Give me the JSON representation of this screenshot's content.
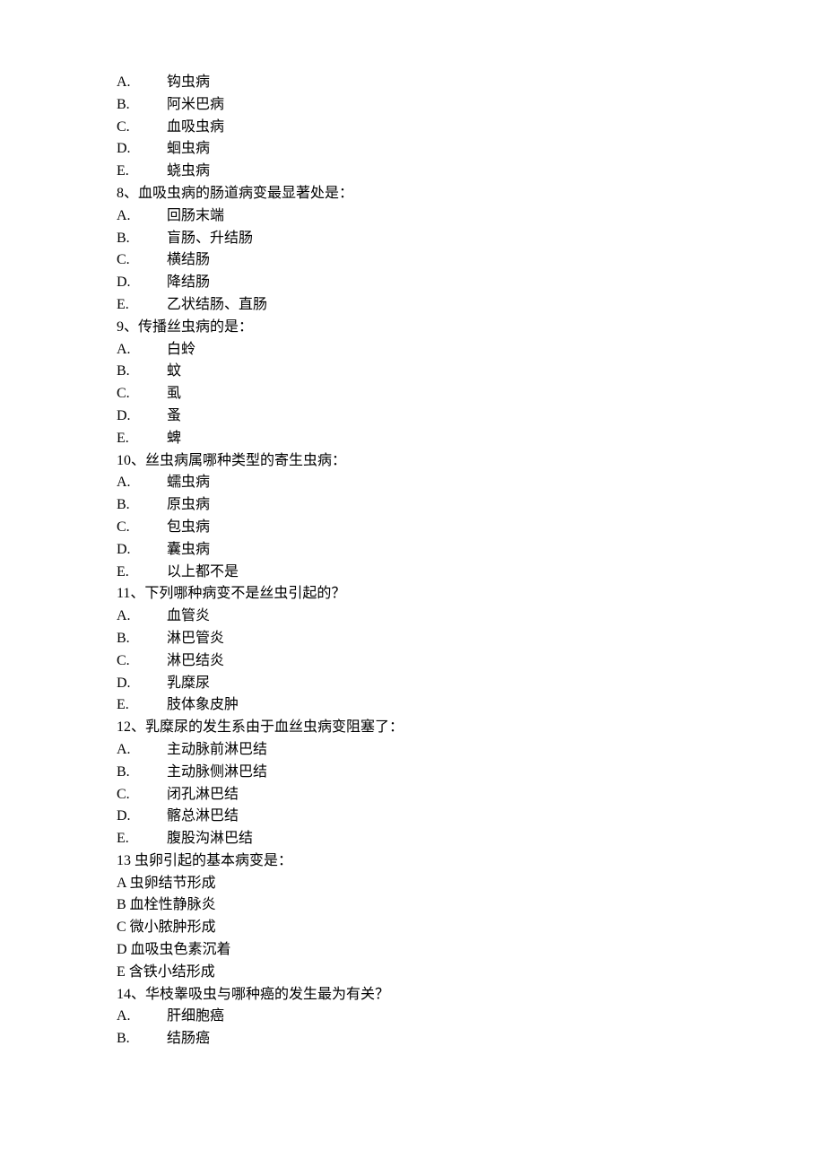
{
  "items": [
    {
      "kind": "option",
      "letter": "A.",
      "text": "钩虫病"
    },
    {
      "kind": "option",
      "letter": "B.",
      "text": "阿米巴病"
    },
    {
      "kind": "option",
      "letter": "C.",
      "text": "血吸虫病"
    },
    {
      "kind": "option",
      "letter": "D.",
      "text": "蛔虫病"
    },
    {
      "kind": "option",
      "letter": "E.",
      "text": "蛲虫病"
    },
    {
      "kind": "question",
      "text": "8、血吸虫病的肠道病变最显著处是："
    },
    {
      "kind": "option",
      "letter": "A.",
      "text": "回肠末端"
    },
    {
      "kind": "option",
      "letter": "B.",
      "text": "盲肠、升结肠"
    },
    {
      "kind": "option",
      "letter": "C.",
      "text": "横结肠"
    },
    {
      "kind": "option",
      "letter": "D.",
      "text": "降结肠"
    },
    {
      "kind": "option",
      "letter": "E.",
      "text": "乙状结肠、直肠"
    },
    {
      "kind": "question",
      "text": "9、传播丝虫病的是："
    },
    {
      "kind": "option",
      "letter": "A.",
      "text": "白蛉"
    },
    {
      "kind": "option",
      "letter": "B.",
      "text": "蚊"
    },
    {
      "kind": "option",
      "letter": "C.",
      "text": "虱"
    },
    {
      "kind": "option",
      "letter": "D.",
      "text": "蚤"
    },
    {
      "kind": "option",
      "letter": "E.",
      "text": "蜱"
    },
    {
      "kind": "question",
      "text": "10、丝虫病属哪种类型的寄生虫病："
    },
    {
      "kind": "option",
      "letter": "A.",
      "text": "蠕虫病"
    },
    {
      "kind": "option",
      "letter": "B.",
      "text": "原虫病"
    },
    {
      "kind": "option",
      "letter": "C.",
      "text": "包虫病"
    },
    {
      "kind": "option",
      "letter": "D.",
      "text": "囊虫病"
    },
    {
      "kind": "option",
      "letter": "E.",
      "text": "以上都不是"
    },
    {
      "kind": "question",
      "text": "11、下列哪种病变不是丝虫引起的？"
    },
    {
      "kind": "option",
      "letter": "A.",
      "text": "血管炎"
    },
    {
      "kind": "option",
      "letter": "B.",
      "text": "淋巴管炎"
    },
    {
      "kind": "option",
      "letter": "C.",
      "text": "淋巴结炎"
    },
    {
      "kind": "option",
      "letter": "D.",
      "text": "乳糜尿"
    },
    {
      "kind": "option",
      "letter": "E.",
      "text": "肢体象皮肿"
    },
    {
      "kind": "question",
      "text": "12、乳糜尿的发生系由于血丝虫病变阻塞了："
    },
    {
      "kind": "option",
      "letter": "A.",
      "text": "主动脉前淋巴结"
    },
    {
      "kind": "option",
      "letter": "B.",
      "text": "主动脉侧淋巴结"
    },
    {
      "kind": "option",
      "letter": "C.",
      "text": "闭孔淋巴结"
    },
    {
      "kind": "option",
      "letter": "D.",
      "text": "髂总淋巴结"
    },
    {
      "kind": "option",
      "letter": "E.",
      "text": "腹股沟淋巴结"
    },
    {
      "kind": "question",
      "text": "13 虫卵引起的基本病变是："
    },
    {
      "kind": "option-plain",
      "text": "A 虫卵结节形成"
    },
    {
      "kind": "option-plain",
      "text": "B 血栓性静脉炎"
    },
    {
      "kind": "option-plain",
      "text": "C 微小脓肿形成"
    },
    {
      "kind": "option-plain",
      "text": "D 血吸虫色素沉着"
    },
    {
      "kind": "option-plain",
      "text": "E 含铁小结形成"
    },
    {
      "kind": "question",
      "text": "14、华枝睾吸虫与哪种癌的发生最为有关？"
    },
    {
      "kind": "option",
      "letter": "A.",
      "text": "肝细胞癌"
    },
    {
      "kind": "option",
      "letter": "B.",
      "text": "结肠癌"
    }
  ]
}
